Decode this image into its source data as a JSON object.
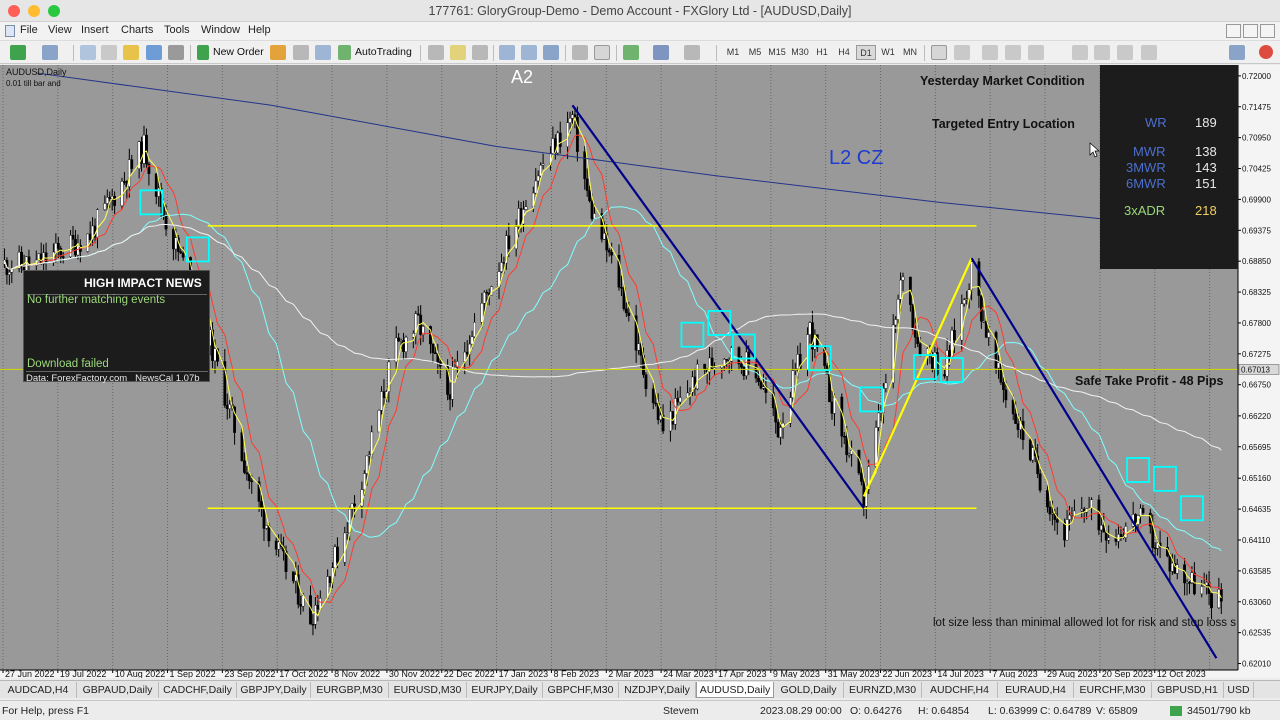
{
  "window": {
    "title": "177761: GloryGroup-Demo - Demo Account - FXGlory Ltd - [AUDUSD,Daily]"
  },
  "menu": [
    "File",
    "View",
    "Insert",
    "Charts",
    "Tools",
    "Window",
    "Help"
  ],
  "toolbar": {
    "new_order_label": "New Order",
    "autotrading_label": "AutoTrading",
    "timeframes": [
      "M1",
      "M5",
      "M15",
      "M30",
      "H1",
      "H4",
      "D1",
      "W1",
      "MN"
    ],
    "active_timeframe": "D1"
  },
  "chart": {
    "symbol_label": "AUDUSD,Daily",
    "sub_label": "0.01 till bar and",
    "overlay_texts": {
      "a2": "A2",
      "l2cz": "L2 CZ",
      "yesterday": "Yesterday Market Condition",
      "targeted": "Targeted Entry Location",
      "safe_tp": "Safe Take Profit - 48 Pips",
      "lot_warning": "lot size less than minimal allowed lot for risk and stop loss s"
    },
    "current_price_label": "0.67013",
    "news_panel": {
      "title": "HIGH IMPACT NEWS",
      "line1": "No further matching events",
      "line2": "Download failed",
      "footer": "Data: ForexFactory.com   NewsCal 1.07b"
    },
    "stats_panel": [
      {
        "label": "WR",
        "value": "189"
      },
      {
        "label": "MWR",
        "value": "138"
      },
      {
        "label": "3MWR",
        "value": "143"
      },
      {
        "label": "6MWR",
        "value": "151"
      },
      {
        "label": "3xADR",
        "value": "218"
      }
    ],
    "colors": {
      "background": "#999999",
      "bull": "#ffffff",
      "bear": "#000000",
      "yellow_line": "#ffff00",
      "blue_line": "#00008b",
      "cyan_box": "#00ffff",
      "ma_red": "#ff3b2f",
      "ma_yellow": "#ffff55",
      "ma_cyan": "#7fffff",
      "ma_white": "#f2f2f2",
      "ma_navy": "#22348a"
    }
  },
  "chart_data": {
    "type": "candlestick",
    "symbol": "AUDUSD",
    "timeframe": "Daily",
    "ylim": [
      0.619,
      0.721
    ],
    "y_ticks": [
      "0.72000",
      "0.71475",
      "0.70950",
      "0.70425",
      "0.69900",
      "0.69375",
      "0.68850",
      "0.68325",
      "0.67800",
      "0.67275",
      "0.66750",
      "0.66220",
      "0.65695",
      "0.65160",
      "0.64635",
      "0.64110",
      "0.63585",
      "0.63060",
      "0.62535",
      "0.62010"
    ],
    "x_ticks": [
      "27 Jun 2022",
      "19 Jul 2022",
      "10 Aug 2022",
      "1 Sep 2022",
      "23 Sep 2022",
      "17 Oct 2022",
      "8 Nov 2022",
      "30 Nov 2022",
      "22 Dec 2022",
      "17 Jan 2023",
      "8 Feb 2023",
      "2 Mar 2023",
      "24 Mar 2023",
      "17 Apr 2023",
      "9 May 2023",
      "31 May 2023",
      "22 Jun 2023",
      "14 Jul 2023",
      "7 Aug 2023",
      "29 Aug 2023",
      "20 Sep 2023",
      "12 Oct 2023"
    ],
    "close_path": [
      [
        "2022-06-27",
        0.688
      ],
      [
        "2022-07-19",
        0.693
      ],
      [
        "2022-08-10",
        0.708
      ],
      [
        "2022-08-20",
        0.694
      ],
      [
        "2022-09-01",
        0.682
      ],
      [
        "2022-09-23",
        0.65
      ],
      [
        "2022-10-05",
        0.638
      ],
      [
        "2022-10-17",
        0.628
      ],
      [
        "2022-10-28",
        0.639
      ],
      [
        "2022-11-08",
        0.653
      ],
      [
        "2022-11-20",
        0.673
      ],
      [
        "2022-11-30",
        0.678
      ],
      [
        "2022-12-12",
        0.666
      ],
      [
        "2022-12-22",
        0.677
      ],
      [
        "2023-01-17",
        0.703
      ],
      [
        "2023-02-01",
        0.713
      ],
      [
        "2023-02-08",
        0.698
      ],
      [
        "2023-02-20",
        0.685
      ],
      [
        "2023-03-02",
        0.67
      ],
      [
        "2023-03-10",
        0.66
      ],
      [
        "2023-03-24",
        0.669
      ],
      [
        "2023-04-05",
        0.673
      ],
      [
        "2023-04-17",
        0.67
      ],
      [
        "2023-04-26",
        0.66
      ],
      [
        "2023-05-09",
        0.677
      ],
      [
        "2023-05-20",
        0.662
      ],
      [
        "2023-05-31",
        0.648
      ],
      [
        "2023-06-10",
        0.67
      ],
      [
        "2023-06-16",
        0.687
      ],
      [
        "2023-06-22",
        0.675
      ],
      [
        "2023-07-03",
        0.67
      ],
      [
        "2023-07-14",
        0.687
      ],
      [
        "2023-07-24",
        0.67
      ],
      [
        "2023-08-07",
        0.656
      ],
      [
        "2023-08-20",
        0.642
      ],
      [
        "2023-08-29",
        0.647
      ],
      [
        "2023-09-10",
        0.642
      ],
      [
        "2023-09-20",
        0.645
      ],
      [
        "2023-10-01",
        0.638
      ],
      [
        "2023-10-12",
        0.634
      ],
      [
        "2023-10-22",
        0.631
      ]
    ],
    "horizontal_lines": [
      {
        "price": 0.6945,
        "color": "yellow"
      },
      {
        "price": 0.6465,
        "color": "yellow"
      },
      {
        "price": 0.6701,
        "color": "yellow",
        "label": "0.67013"
      }
    ],
    "trendlines": [
      {
        "color": "navy",
        "from": [
          "2023-02-01",
          0.715
        ],
        "to": [
          "2023-05-31",
          0.6465
        ]
      },
      {
        "color": "yellow",
        "from": [
          "2023-05-31",
          0.6485
        ],
        "to": [
          "2023-07-14",
          0.689
        ]
      },
      {
        "color": "navy",
        "from": [
          "2023-07-14",
          0.689
        ],
        "to": [
          "2023-10-22",
          0.621
        ]
      }
    ]
  },
  "symbol_tabs": [
    "AUDCAD,H4",
    "GBPAUD,Daily",
    "CADCHF,Daily",
    "GBPJPY,Daily",
    "EURGBP,M30",
    "EURUSD,M30",
    "EURJPY,Daily",
    "GBPCHF,M30",
    "NZDJPY,Daily",
    "AUDUSD,Daily",
    "GOLD,Daily",
    "EURNZD,M30",
    "AUDCHF,H4",
    "EURAUD,H4",
    "EURCHF,M30",
    "GBPUSD,H1",
    "USD"
  ],
  "active_tab": "AUDUSD,Daily",
  "status": {
    "help": "For Help, press F1",
    "profile": "Stevem",
    "datetime": "2023.08.29 00:00",
    "open": "O: 0.64276",
    "high": "H: 0.64854",
    "low": "L: 0.63999",
    "close": "C: 0.64789",
    "volume": "V: 65809",
    "traffic": "34501/790 kb"
  }
}
